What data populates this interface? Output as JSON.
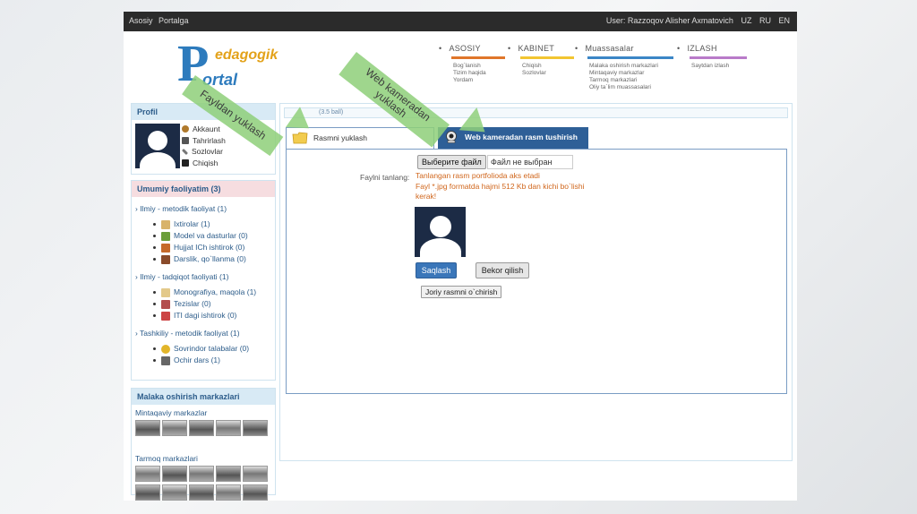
{
  "topbar": {
    "left_links": [
      "Asosiy",
      "Portalga"
    ],
    "user_label": "User: Razzoqov Alisher Axmatovich",
    "languages": [
      "UZ",
      "RU",
      "EN"
    ]
  },
  "logo": {
    "letter": "P",
    "line1": "edagogik",
    "line2": "ortal"
  },
  "nav": [
    {
      "label": "ASOSIY",
      "color": "#e0762a",
      "items": [
        "Bog`lanish",
        "Tizim haqida",
        "Yordam"
      ]
    },
    {
      "label": "KABINET",
      "color": "#f2c531",
      "items": [
        "Chiqish",
        "Sozlovlar"
      ]
    },
    {
      "label": "Muassasalar",
      "color": "#3b86c6",
      "items": [
        "Malaka oshirish markazlari",
        "Mintaqaviy markazlar",
        "Tarmoq markazlari",
        "Oliy ta`lim muassasalari"
      ]
    },
    {
      "label": "IZLASH",
      "color": "#b97bc9",
      "items": [
        "Saytdan izlash"
      ]
    }
  ],
  "profile": {
    "title": "Profil",
    "links": [
      "Akkaunt",
      "Tahrirlash",
      "Sozlovlar",
      "Chiqish"
    ]
  },
  "activity": {
    "title": "Umumiy faoliyatim (3)",
    "sections": [
      {
        "label": "› Ilmiy - metodik faoliyat (1)",
        "items": [
          "Ixtirolar (1)",
          "Model va dasturlar (0)",
          "Hujjat ICh ishtirok (0)",
          "Darslik, qo`llanma (0)"
        ]
      },
      {
        "label": "› Ilmiy - tadqiqot faoliyati (1)",
        "items": [
          "Monografiya, maqola (1)",
          "Tezislar (0)",
          "ITI dagi ishtirok (0)"
        ]
      },
      {
        "label": "› Tashkiliy - metodik faoliyat (1)",
        "items": [
          "Sovrindor talabalar (0)",
          "Ochir dars (1)"
        ]
      }
    ]
  },
  "centers": {
    "title": "Malaka oshirish markazlari",
    "regional": "Mintaqaviy markazlar",
    "network": "Tarmoq markazlari"
  },
  "main": {
    "progress_text": "(3.5 ball)",
    "tab_upload": "Rasmni yuklash",
    "tab_webcam": "Web kameradan rasm tushirish",
    "file_button": "Выберите файл",
    "file_status": "Файл не выбран",
    "field_label": "Faylni tanlang:",
    "hint_lines": [
      "Tanlangan rasm portfolioda aks etadi",
      "Fayl *.jpg formatda hajmi 512 Kb dan kichi bo`lishi kerak!"
    ],
    "save_label": "Saqlash",
    "cancel_label": "Bekor qilish",
    "delete_label": "Joriy rasmni o`chirish"
  },
  "callouts": {
    "upload": "Fayldan yuklash",
    "webcam_line1": "Web kameradan",
    "webcam_line2": "yuklash",
    "color": "#8fd07a"
  }
}
